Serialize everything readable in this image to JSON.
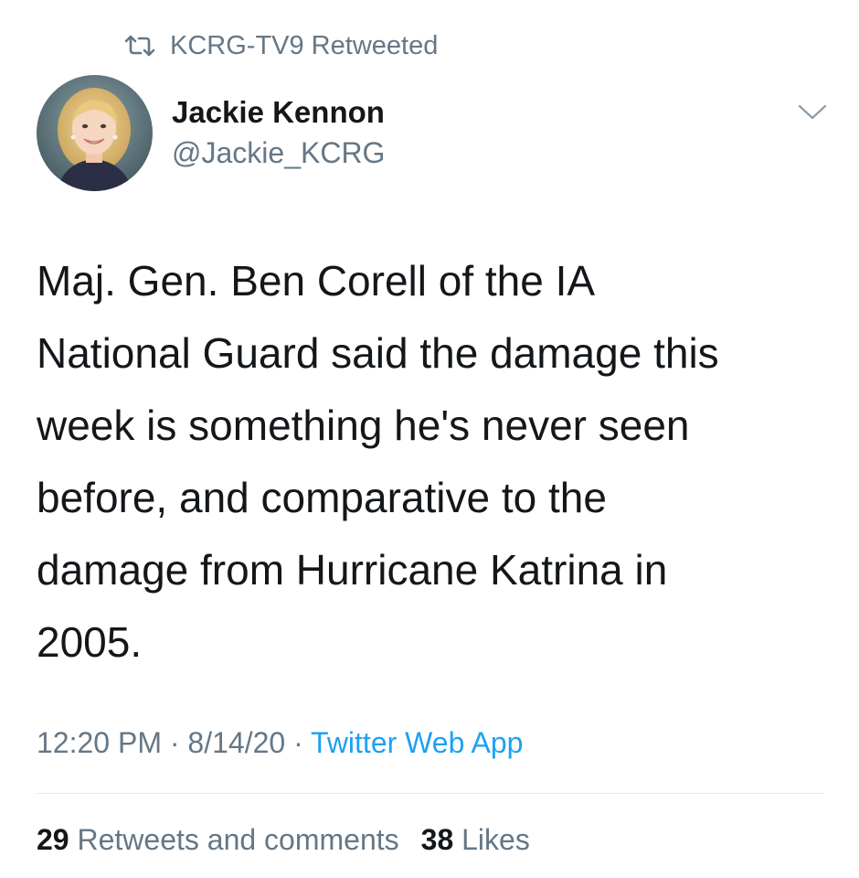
{
  "retweet": {
    "icon": "retweet-icon",
    "text": "KCRG-TV9 Retweeted"
  },
  "author": {
    "avatar_icon": "profile-photo",
    "name": "Jackie Kennon",
    "handle": "@Jackie_KCRG"
  },
  "menu_icon": "chevron-down-icon",
  "tweet": {
    "text": "Maj. Gen. Ben Corell of the IA\nNational Guard said the damage this\nweek is something he's never seen\nbefore, and comparative to the\ndamage from Hurricane Katrina in\n2005."
  },
  "meta": {
    "time": "12:20 PM",
    "separator": "·",
    "date": "8/14/20",
    "source": "Twitter Web App"
  },
  "stats": {
    "retweets_count": "29",
    "retweets_label": "Retweets and comments",
    "likes_count": "38",
    "likes_label": "Likes"
  },
  "colors": {
    "secondary_text": "#657786",
    "link": "#1da1f2",
    "primary_text": "#14171a",
    "divider": "#e1e8ed"
  }
}
